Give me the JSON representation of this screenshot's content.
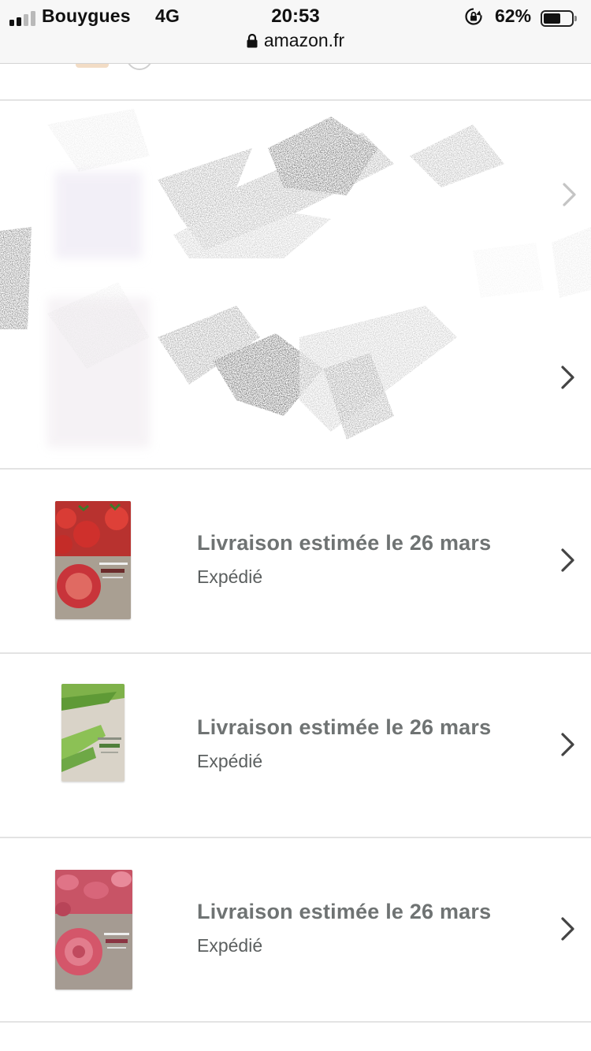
{
  "status_bar": {
    "carrier": "Bouygues",
    "network": "4G",
    "time": "20:53",
    "battery_percent": "62%",
    "battery_level": 0.62,
    "signal_bars": 4,
    "signal_bars_filled": 2
  },
  "url_bar": {
    "domain": "amazon.fr",
    "icon": "lock-icon"
  },
  "orders": [
    {
      "title": "Livraison estimée le 26 mars",
      "status": "Expédié",
      "product": "tomato sheet mask",
      "accent_color": "#c8343a"
    },
    {
      "title": "Livraison estimée le 26 mars",
      "status": "Expédié",
      "product": "aloe sheet mask",
      "accent_color": "#7fb24a"
    },
    {
      "title": "Livraison estimée le 26 mars",
      "status": "Expédié",
      "product": "rose sheet mask",
      "accent_color": "#d4566a"
    }
  ],
  "colors": {
    "title_text": "#6f7373",
    "status_text": "#5b5f5f",
    "divider": "#e3e3e3",
    "topbar_bg": "#f7f7f7"
  }
}
